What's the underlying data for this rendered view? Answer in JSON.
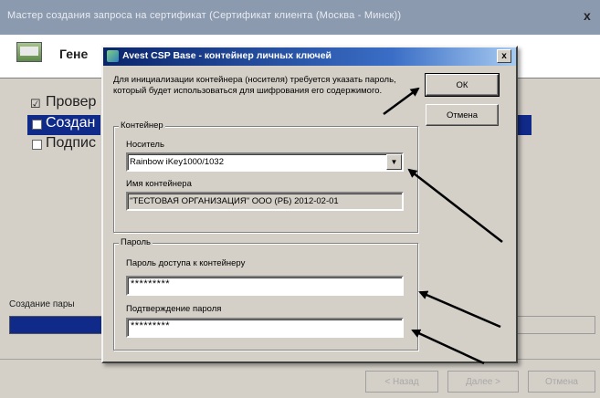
{
  "background_window": {
    "title": "Мастер создания запроса на сертификат (Сертификат клиента (Москва - Минск))",
    "close_label": "x",
    "header_text": "Гене",
    "steps": [
      {
        "label": "Провер",
        "checked": true
      },
      {
        "label": "Создан",
        "checked": false,
        "active": true
      },
      {
        "label": "Подпис",
        "checked": false
      }
    ],
    "progress_label": "Создание пары",
    "buttons": {
      "back": "< Назад",
      "next": "Далее >",
      "cancel": "Отмена"
    }
  },
  "dialog": {
    "title": "Avest CSP Base - контейнер личных ключей",
    "close_label": "x",
    "description": "Для инициализации контейнера (носителя) требуется указать пароль, который будет использоваться для шифрования его содержимого.",
    "ok_label": "ОК",
    "cancel_label": "Отмена",
    "container_group": {
      "label": "Контейнер",
      "carrier_label": "Носитель",
      "carrier_value": "Rainbow iKey1000/1032",
      "name_label": "Имя контейнера",
      "name_value": "\"ТЕСТОВАЯ ОРГАНИЗАЦИЯ\" ООО (РБ) 2012-02-01"
    },
    "password_group": {
      "label": "Пароль",
      "password_label": "Пароль доступа к контейнеру",
      "password_value": "*********",
      "confirm_label": "Подтверждение пароля",
      "confirm_value": "*********"
    }
  },
  "annotation_color": "#000000"
}
